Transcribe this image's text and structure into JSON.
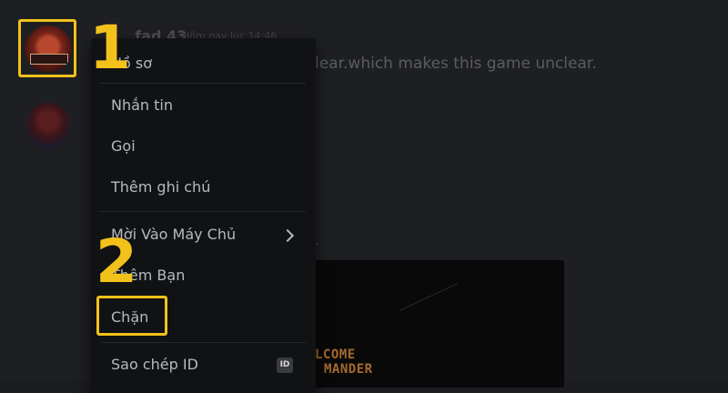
{
  "chat": {
    "username": "...fad 43",
    "timestamp": "Hôm nay lúc 14:46",
    "message_fragment": "lear.which makes this game unclear.",
    "partial_text": "r",
    "embed_lines": [
      "LCOME",
      "MANDER"
    ]
  },
  "annotations": {
    "step_1": "1",
    "step_2": "2"
  },
  "context_menu": {
    "items": [
      {
        "label": "Hồ sơ"
      },
      {
        "label": "Nhắn tin"
      },
      {
        "label": "Gọi"
      },
      {
        "label": "Thêm ghi chú"
      },
      {
        "label": "Mời Vào Máy Chủ"
      },
      {
        "label": "Thêm Bạn"
      },
      {
        "label": "Chặn"
      },
      {
        "label": "Sao chép ID"
      }
    ],
    "id_badge": "ID"
  },
  "colors": {
    "highlight": "#f2c21b",
    "menu_bg": "#111214",
    "menu_text": "#b5bac1"
  }
}
